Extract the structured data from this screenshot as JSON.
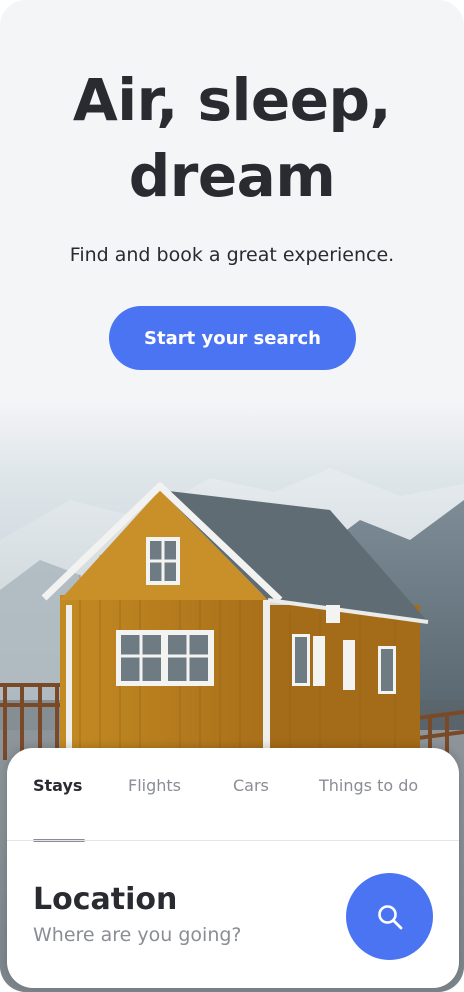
{
  "hero": {
    "title_line1": "Air, sleep,",
    "title_line2": "dream",
    "subtitle": "Find and book a great experience.",
    "cta_label": "Start your search"
  },
  "search_panel": {
    "tabs": [
      {
        "label": "Stays",
        "active": true
      },
      {
        "label": "Flights",
        "active": false
      },
      {
        "label": "Cars",
        "active": false
      },
      {
        "label": "Things to do",
        "active": false
      }
    ],
    "location_label": "Location",
    "location_placeholder": "Where are you going?",
    "search_icon": "search-icon"
  },
  "colors": {
    "accent": "#4a74f2",
    "text_dark": "#2a2b31",
    "text_muted": "#8a8d94",
    "background": "#f4f5f7",
    "house_yellow": "#d19a2c"
  }
}
